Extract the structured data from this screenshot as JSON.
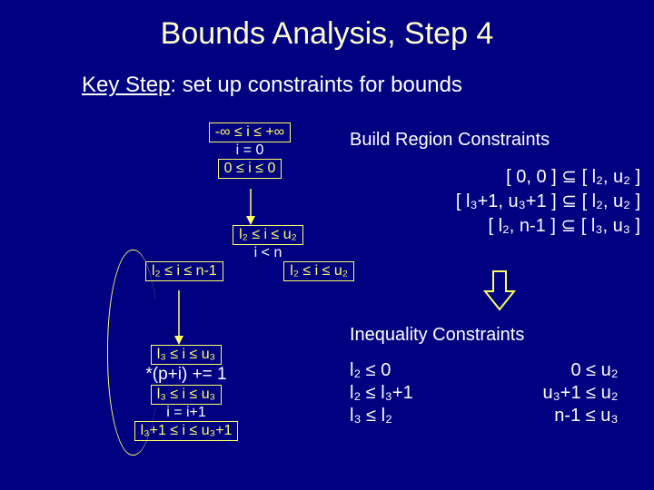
{
  "title": "Bounds Analysis, Step 4",
  "subtitle_prefix": "Key Step",
  "subtitle_rest": ": set up constraints for bounds",
  "node1": {
    "yellow_top": "-∞ ≤ i ≤ +∞",
    "white": "i = 0",
    "yellow_bot": "0 ≤ i ≤ 0"
  },
  "node2": {
    "yellow_top": "l₂ ≤ i ≤ u₂",
    "white": "i < n",
    "left": "l₂ ≤ i ≤ n-1",
    "right": "l₂ ≤ i ≤ u₂"
  },
  "node3": {
    "yellow_top": "l₃ ≤ i ≤ u₃",
    "white": "*(p+i) += 1",
    "yellow_mid": "l₃ ≤ i ≤ u₃",
    "white2": "i = i+1",
    "yellow_bot": "l₃+1 ≤ i ≤ u₃+1"
  },
  "right": {
    "build_header": "Build Region Constraints",
    "r1": "[ 0, 0 ] ⊆ [ l₂, u₂ ]",
    "r2": "[ l₃+1, u₃+1 ] ⊆ [ l₂, u₂ ]",
    "r3": "[ l₂, n-1 ] ⊆ [ l₃, u₃ ]",
    "ineq_header": "Inequality Constraints",
    "c1a": "l₂ ≤ 0",
    "c1b": "0 ≤ u₂",
    "c2a": "l₂ ≤ l₃+1",
    "c2b": "u₃+1 ≤ u₂",
    "c3a": "l₃ ≤ l₂",
    "c3b": "n-1 ≤ u₃"
  }
}
